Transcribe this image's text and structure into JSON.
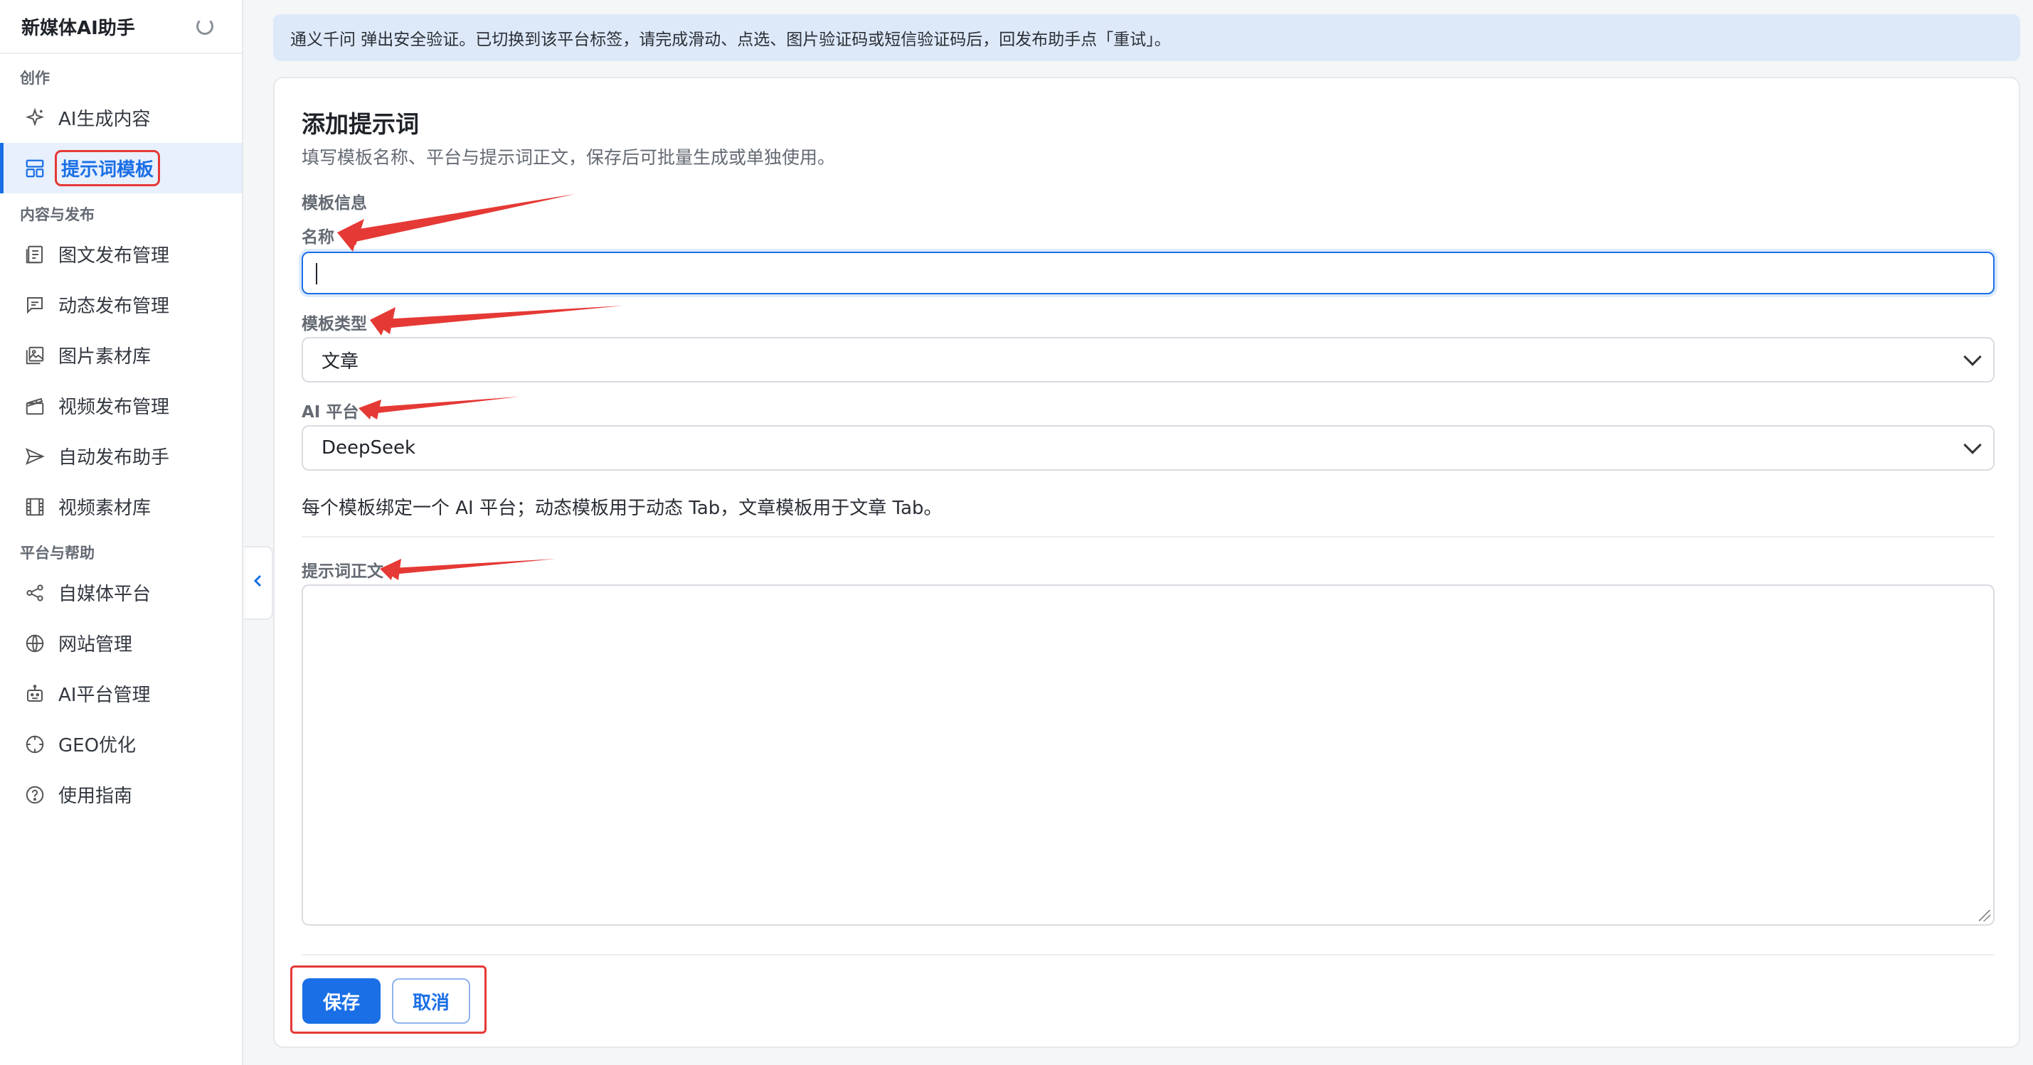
{
  "sidebar": {
    "brand": "新媒体AI助手",
    "groups": [
      {
        "title": "创作"
      },
      {
        "title": "内容与发布"
      },
      {
        "title": "平台与帮助"
      }
    ],
    "items": [
      {
        "label": "AI生成内容",
        "icon": "sparkle-icon"
      },
      {
        "label": "提示词模板",
        "icon": "template-icon",
        "active": true
      },
      {
        "label": "图文发布管理",
        "icon": "article-icon"
      },
      {
        "label": "动态发布管理",
        "icon": "message-icon"
      },
      {
        "label": "图片素材库",
        "icon": "image-icon"
      },
      {
        "label": "视频发布管理",
        "icon": "clapper-icon"
      },
      {
        "label": "自动发布助手",
        "icon": "send-icon"
      },
      {
        "label": "视频素材库",
        "icon": "film-icon"
      },
      {
        "label": "自媒体平台",
        "icon": "share-icon"
      },
      {
        "label": "网站管理",
        "icon": "globe-icon"
      },
      {
        "label": "AI平台管理",
        "icon": "robot-icon"
      },
      {
        "label": "GEO优化",
        "icon": "crosshair-icon"
      },
      {
        "label": "使用指南",
        "icon": "help-icon"
      }
    ]
  },
  "notice": "通义千问 弹出安全验证。已切换到该平台标签，请完成滑动、点选、图片验证码或短信验证码后，回发布助手点「重试」。",
  "form": {
    "title": "添加提示词",
    "subtitle": "填写模板名称、平台与提示词正文，保存后可批量生成或单独使用。",
    "section": "模板信息",
    "name_label": "名称",
    "name_value": "",
    "type_label": "模板类型",
    "type_value": "文章",
    "platform_label": "AI 平台",
    "platform_value": "DeepSeek",
    "hint": "每个模板绑定一个 AI 平台；动态模板用于动态 Tab，文章模板用于文章 Tab。",
    "body_label": "提示词正文",
    "body_value": "",
    "save_label": "保存",
    "cancel_label": "取消"
  },
  "colors": {
    "accent": "#1a6fe6",
    "annotation": "#e53935",
    "notice_bg": "#dde9f9"
  }
}
